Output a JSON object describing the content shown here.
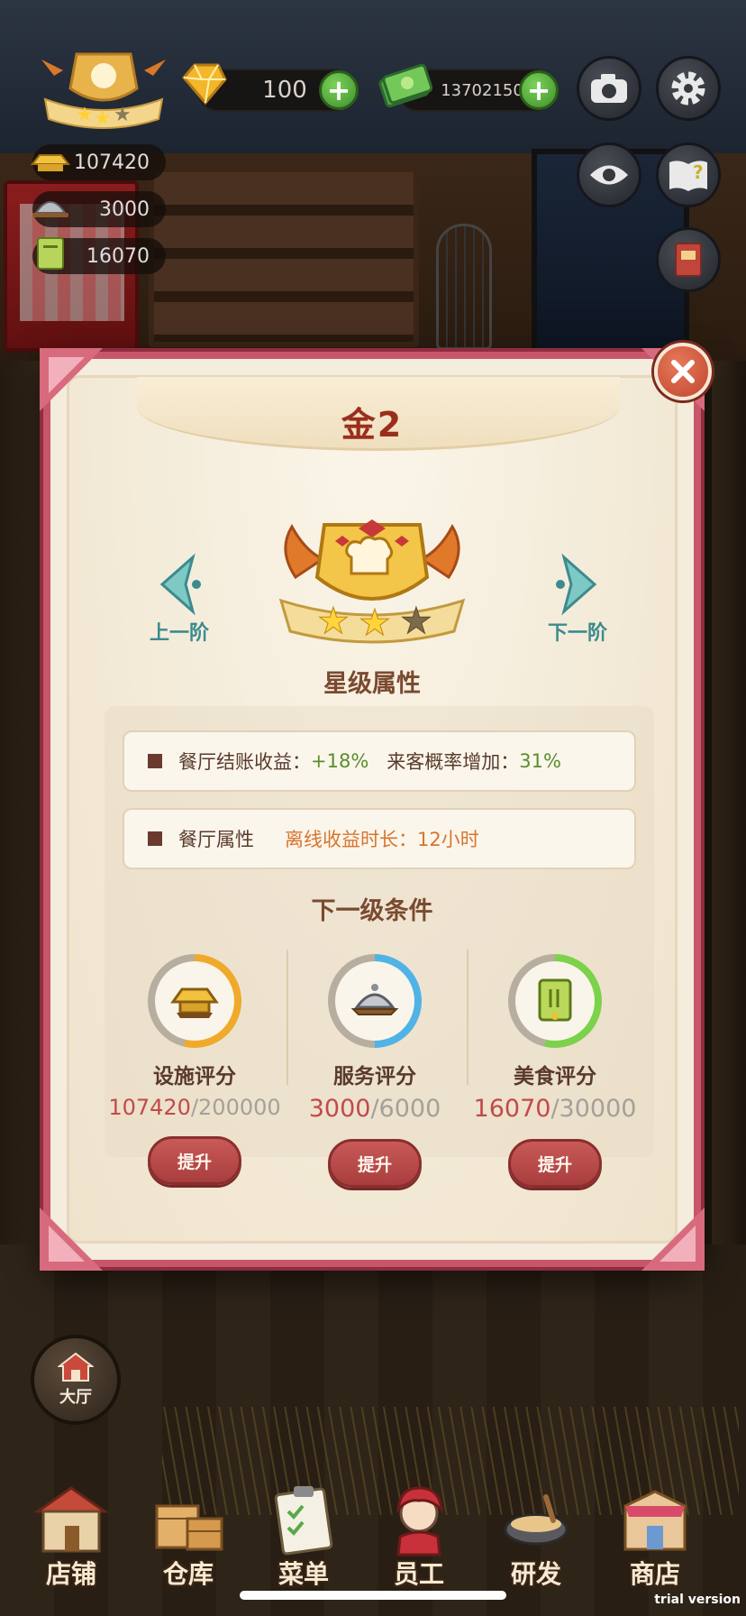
{
  "hud": {
    "gems": "100",
    "cash": "13702150",
    "facility_score": "107420",
    "service_score": "3000",
    "food_score": "16070",
    "icons": [
      "rank-badge-icon",
      "gem-icon",
      "cash-icon",
      "camera-icon",
      "gear-icon",
      "eye-icon",
      "help-book-icon",
      "recipe-book-icon"
    ]
  },
  "modal": {
    "title": "金2",
    "prev_label": "上一阶",
    "next_label": "下一阶",
    "badge_stars_filled": 2,
    "badge_stars_total": 3,
    "star_section_title": "星级属性",
    "attr1_label": "餐厅结账收益：",
    "attr1_value": "+18%",
    "attr1b_label": "来客概率增加：",
    "attr1b_value": "31%",
    "attr2_label": "餐厅属性",
    "attr2_sub_label": "离线收益时长：",
    "attr2_value": "12小时",
    "next_section_title": "下一级条件",
    "requirements": [
      {
        "name": "设施评分",
        "current": "107420",
        "target": "/200000",
        "progress": 0.537,
        "color": "#f0a92a",
        "icon": "gold-ingot-icon"
      },
      {
        "name": "服务评分",
        "current": "3000",
        "target": "/6000",
        "progress": 0.5,
        "color": "#4fb3e6",
        "icon": "serving-cloche-icon"
      },
      {
        "name": "美食评分",
        "current": "16070",
        "target": "/30000",
        "progress": 0.536,
        "color": "#7cd24a",
        "icon": "menu-book-icon"
      }
    ],
    "upgrade_label": "提升"
  },
  "hall_label": "大厅",
  "bottom_nav": [
    {
      "label": "店铺",
      "icon": "shop-icon"
    },
    {
      "label": "仓库",
      "icon": "warehouse-icon"
    },
    {
      "label": "菜单",
      "icon": "menu-clipboard-icon"
    },
    {
      "label": "员工",
      "icon": "staff-icon"
    },
    {
      "label": "研发",
      "icon": "research-pot-icon"
    },
    {
      "label": "商店",
      "icon": "store-icon"
    }
  ],
  "watermark": "trial version",
  "colors": {
    "accent_pink": "#c8566a",
    "teal": "#3b8b8f",
    "green": "#5a8e2c",
    "orange": "#d8742c",
    "button_red": "#a93e3e"
  }
}
